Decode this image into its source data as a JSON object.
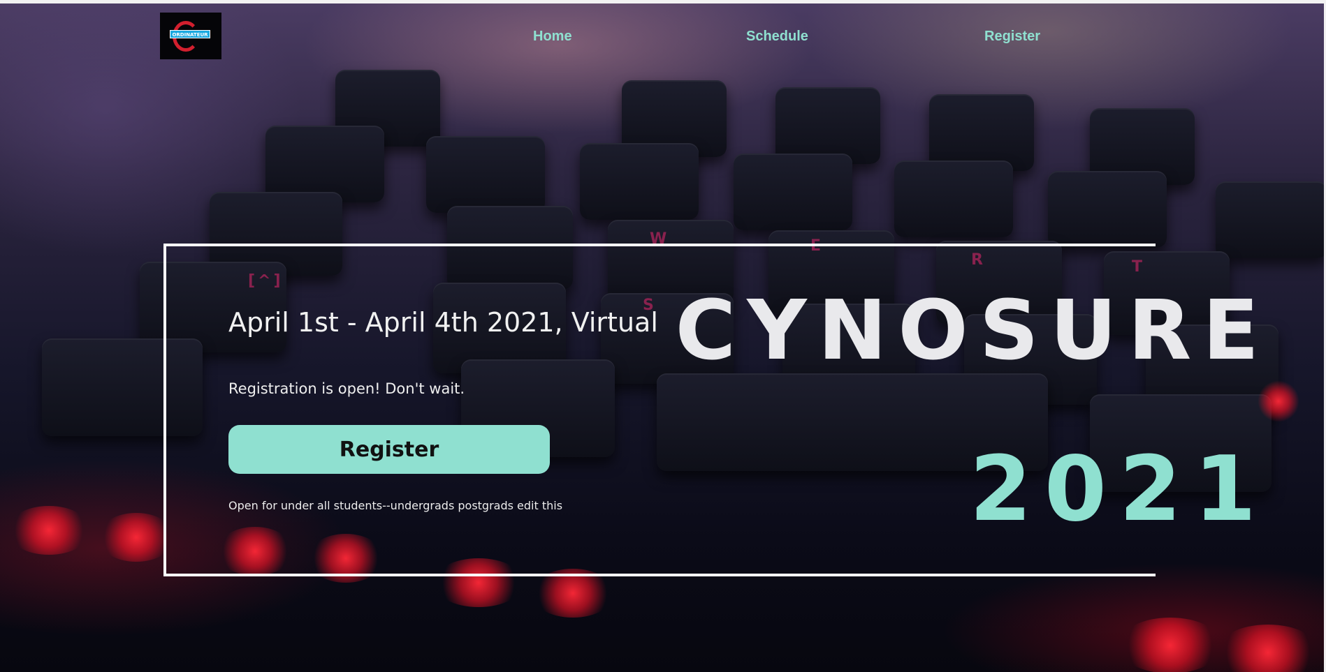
{
  "logo": {
    "text": "ORDINATEUR"
  },
  "nav": {
    "items": [
      {
        "label": "Home"
      },
      {
        "label": "Schedule"
      },
      {
        "label": "Register"
      }
    ]
  },
  "hero": {
    "dates": "April 1st - April 4th 2021, Virtual",
    "registration_status": "Registration is open! Don't wait.",
    "register_button": "Register",
    "fine_print": "Open for under all students--undergrads postgrads edit this",
    "title": "CYNOSURE",
    "year": "2021"
  },
  "colors": {
    "accent": "#8fe0d0",
    "title_text": "#e9e9ec",
    "frame": "#ffffff",
    "background_dark": "#0b0b18",
    "glow_red": "#ff2838"
  }
}
